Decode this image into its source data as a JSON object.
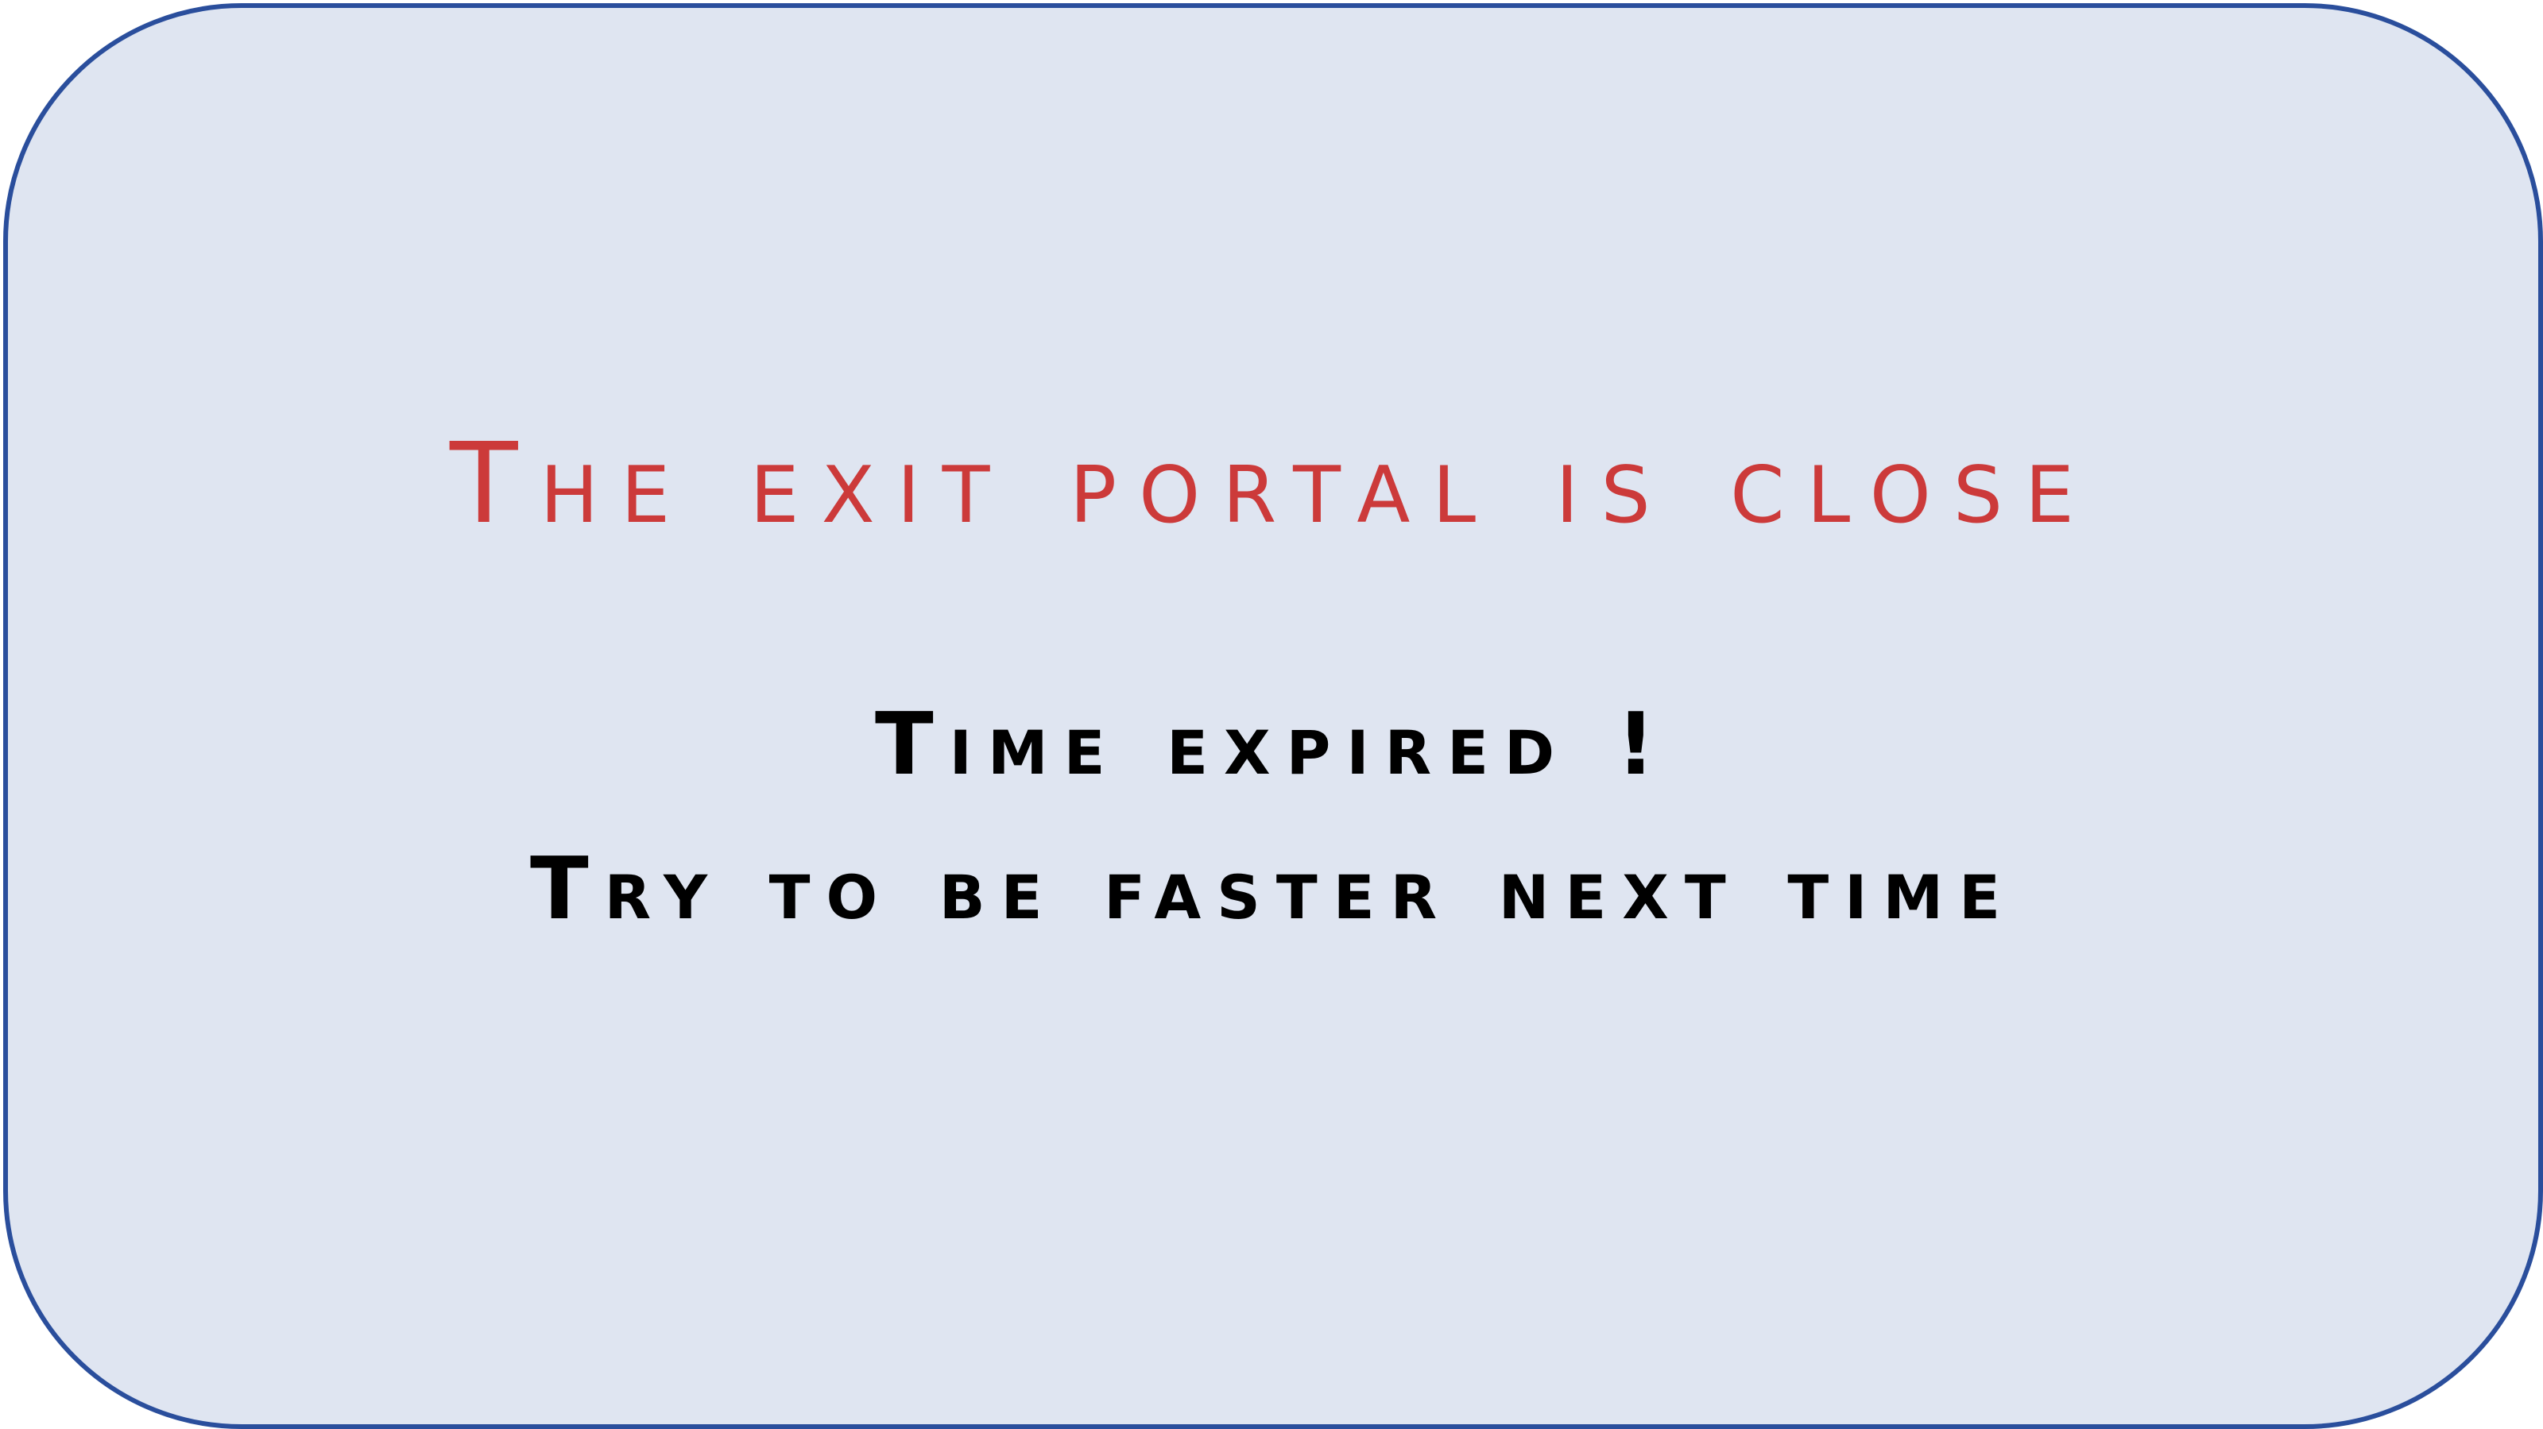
{
  "screen": {
    "title": "The exit portal is close",
    "message_line1": "Time expired !",
    "message_line2": "Try to be faster next time"
  },
  "colors": {
    "background": "#dfe5f1",
    "border": "#2a4e9c",
    "title": "#cc3a3a",
    "message": "#000000"
  }
}
